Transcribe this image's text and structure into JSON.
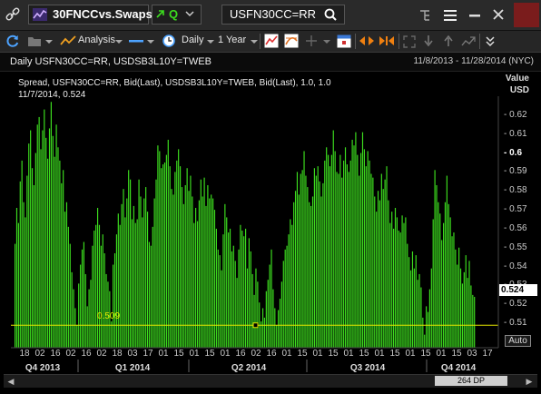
{
  "window": {
    "title": "30FNCCvs.Swaps",
    "quote_button_label": "Q",
    "symbol_input_value": "USFN30CC=RR",
    "icons": [
      "link-icon",
      "chart-trend-icon",
      "search-icon",
      "tree-icon",
      "menu-icon",
      "minimize-icon",
      "close-icon"
    ]
  },
  "toolbar": {
    "analysis_label": "Analysis",
    "interval_label": "Daily",
    "range_label": "1 Year",
    "icons": [
      "refresh-icon",
      "folder-icon",
      "line-style-icon",
      "clock-icon",
      "chart-type-icon",
      "fib-icon",
      "crosshair-icon",
      "calendar-icon",
      "arrows-icon",
      "zoom-icon",
      "expand-icon"
    ]
  },
  "chart_header": {
    "left": "Daily USFN30CC=RR, USDSB3L10Y=TWEB",
    "right": "11/8/2013 - 11/28/2014 (NYC)"
  },
  "legend": {
    "line1": "Spread, USFN30CC=RR, Bid(Last), USDSB3L10Y=TWEB, Bid(Last),  1.0, 1.0",
    "line2": "11/7/2014, 0.524"
  },
  "axis": {
    "value_label": "Value",
    "unit_label": "USD",
    "last_value": "0.524",
    "auto_label": "Auto",
    "ref_value_label": "0.509",
    "scroll_label": "264 DP"
  },
  "chart_data": {
    "type": "bar",
    "title": "Daily USFN30CC=RR, USDSB3L10Y=TWEB",
    "ylabel": "Value USD",
    "ylim": [
      0.5,
      0.63
    ],
    "yticks": [
      "0.62",
      "0.61",
      "0.6",
      "0.59",
      "0.58",
      "0.57",
      "0.56",
      "0.55",
      "0.54",
      "0.53",
      "0.52",
      "0.51"
    ],
    "bold_ytick": "0.6",
    "reference_line": 0.509,
    "last_value": 0.524,
    "color": "#3cdc1e",
    "xticks": [
      "18",
      "02",
      "16",
      "02",
      "16",
      "02",
      "18",
      "03",
      "17",
      "01",
      "15",
      "01",
      "15",
      "01",
      "16",
      "02",
      "16",
      "01",
      "15",
      "01",
      "15",
      "01",
      "15",
      "01",
      "15",
      "01",
      "15",
      "01",
      "15",
      "03",
      "17"
    ],
    "quarters": [
      "Q4 2013",
      "Q1 2014",
      "Q2 2014",
      "Q3 2014",
      "Q4 2014"
    ],
    "values": [
      0.552,
      0.571,
      0.563,
      0.585,
      0.596,
      0.574,
      0.566,
      0.588,
      0.605,
      0.612,
      0.592,
      0.583,
      0.6,
      0.615,
      0.619,
      0.602,
      0.612,
      0.623,
      0.608,
      0.597,
      0.613,
      0.627,
      0.609,
      0.598,
      0.615,
      0.603,
      0.596,
      0.584,
      0.591,
      0.569,
      0.574,
      0.561,
      0.552,
      0.537,
      0.528,
      0.518,
      0.509,
      0.531,
      0.541,
      0.549,
      0.553,
      0.536,
      0.519,
      0.528,
      0.533,
      0.551,
      0.559,
      0.562,
      0.571,
      0.562,
      0.551,
      0.557,
      0.547,
      0.536,
      0.532,
      0.527,
      0.511,
      0.541,
      0.547,
      0.557,
      0.568,
      0.562,
      0.573,
      0.581,
      0.566,
      0.576,
      0.591,
      0.586,
      0.565,
      0.572,
      0.563,
      0.565,
      0.586,
      0.577,
      0.566,
      0.576,
      0.582,
      0.569,
      0.553,
      0.551,
      0.561,
      0.576,
      0.586,
      0.604,
      0.601,
      0.592,
      0.594,
      0.595,
      0.599,
      0.607,
      0.593,
      0.581,
      0.578,
      0.59,
      0.596,
      0.602,
      0.593,
      0.582,
      0.573,
      0.583,
      0.592,
      0.58,
      0.588,
      0.577,
      0.563,
      0.571,
      0.564,
      0.575,
      0.586,
      0.577,
      0.587,
      0.572,
      0.583,
      0.576,
      0.578,
      0.576,
      0.57,
      0.56,
      0.549,
      0.546,
      0.538,
      0.557,
      0.573,
      0.566,
      0.558,
      0.56,
      0.548,
      0.551,
      0.543,
      0.534,
      0.549,
      0.562,
      0.559,
      0.556,
      0.56,
      0.539,
      0.555,
      0.548,
      0.536,
      0.525,
      0.539,
      0.532,
      0.521,
      0.511,
      0.518,
      0.513,
      0.527,
      0.533,
      0.541,
      0.549,
      0.528,
      0.518,
      0.509,
      0.517,
      0.523,
      0.532,
      0.543,
      0.549,
      0.551,
      0.557,
      0.565,
      0.562,
      0.574,
      0.58,
      0.59,
      0.578,
      0.589,
      0.591,
      0.601,
      0.588,
      0.582,
      0.574,
      0.572,
      0.577,
      0.592,
      0.588,
      0.593,
      0.585,
      0.577,
      0.584,
      0.596,
      0.603,
      0.599,
      0.593,
      0.599,
      0.612,
      0.601,
      0.59,
      0.589,
      0.599,
      0.587,
      0.596,
      0.603,
      0.594,
      0.59,
      0.596,
      0.607,
      0.604,
      0.611,
      0.599,
      0.588,
      0.6,
      0.611,
      0.602,
      0.593,
      0.601,
      0.596,
      0.589,
      0.587,
      0.577,
      0.569,
      0.58,
      0.575,
      0.589,
      0.581,
      0.586,
      0.593,
      0.575,
      0.563,
      0.569,
      0.56,
      0.571,
      0.566,
      0.559,
      0.558,
      0.567,
      0.563,
      0.566,
      0.552,
      0.545,
      0.538,
      0.548,
      0.539,
      0.546,
      0.533,
      0.536,
      0.529,
      0.513,
      0.504,
      0.519,
      0.516,
      0.528,
      0.539,
      0.565,
      0.591,
      0.583,
      0.574,
      0.568,
      0.554,
      0.563,
      0.574,
      0.588,
      0.573,
      0.566,
      0.556,
      0.558,
      0.549,
      0.541,
      0.55,
      0.539,
      0.531,
      0.537,
      0.546,
      0.534,
      0.543,
      0.53,
      0.525,
      0.524
    ]
  }
}
